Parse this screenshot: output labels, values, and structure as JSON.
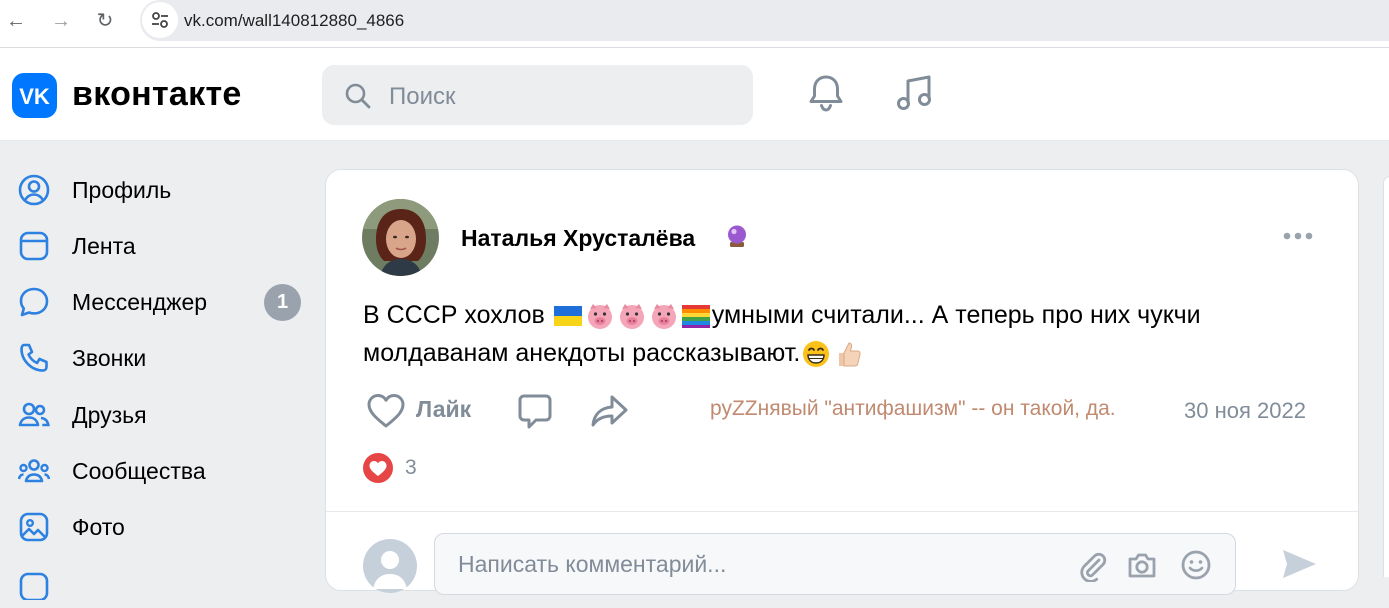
{
  "browser": {
    "url": "vk.com/wall140812880_4866"
  },
  "header": {
    "logo_text": "вконтакте",
    "search_placeholder": "Поиск"
  },
  "sidebar": {
    "items": [
      {
        "label": "Профиль",
        "icon": "profile-icon"
      },
      {
        "label": "Лента",
        "icon": "feed-icon"
      },
      {
        "label": "Мессенджер",
        "icon": "messenger-icon",
        "badge": "1"
      },
      {
        "label": "Звонки",
        "icon": "phone-icon"
      },
      {
        "label": "Друзья",
        "icon": "friends-icon"
      },
      {
        "label": "Сообщества",
        "icon": "communities-icon"
      },
      {
        "label": "Фото",
        "icon": "photo-icon"
      }
    ]
  },
  "post": {
    "author": "Наталья Хрусталёва",
    "text_part1": "В СССР хохлов ",
    "text_part2": "умными считали... А теперь про них чукчи молдаванам анекдоты рассказывают.",
    "like_label": "Лайк",
    "overlay_comment": "руZZнявый \"антифашизм\" -- он такой, да.",
    "date": "30 ноя 2022",
    "reaction_count": "3"
  },
  "comment": {
    "placeholder": "Написать комментарий..."
  },
  "colors": {
    "vk_blue": "#0077ff",
    "icon_blue": "#2a5885",
    "muted": "#818c99",
    "badge": "#99a2ad",
    "reaction_red": "#e64646",
    "overlay_text": "#c08a70"
  }
}
